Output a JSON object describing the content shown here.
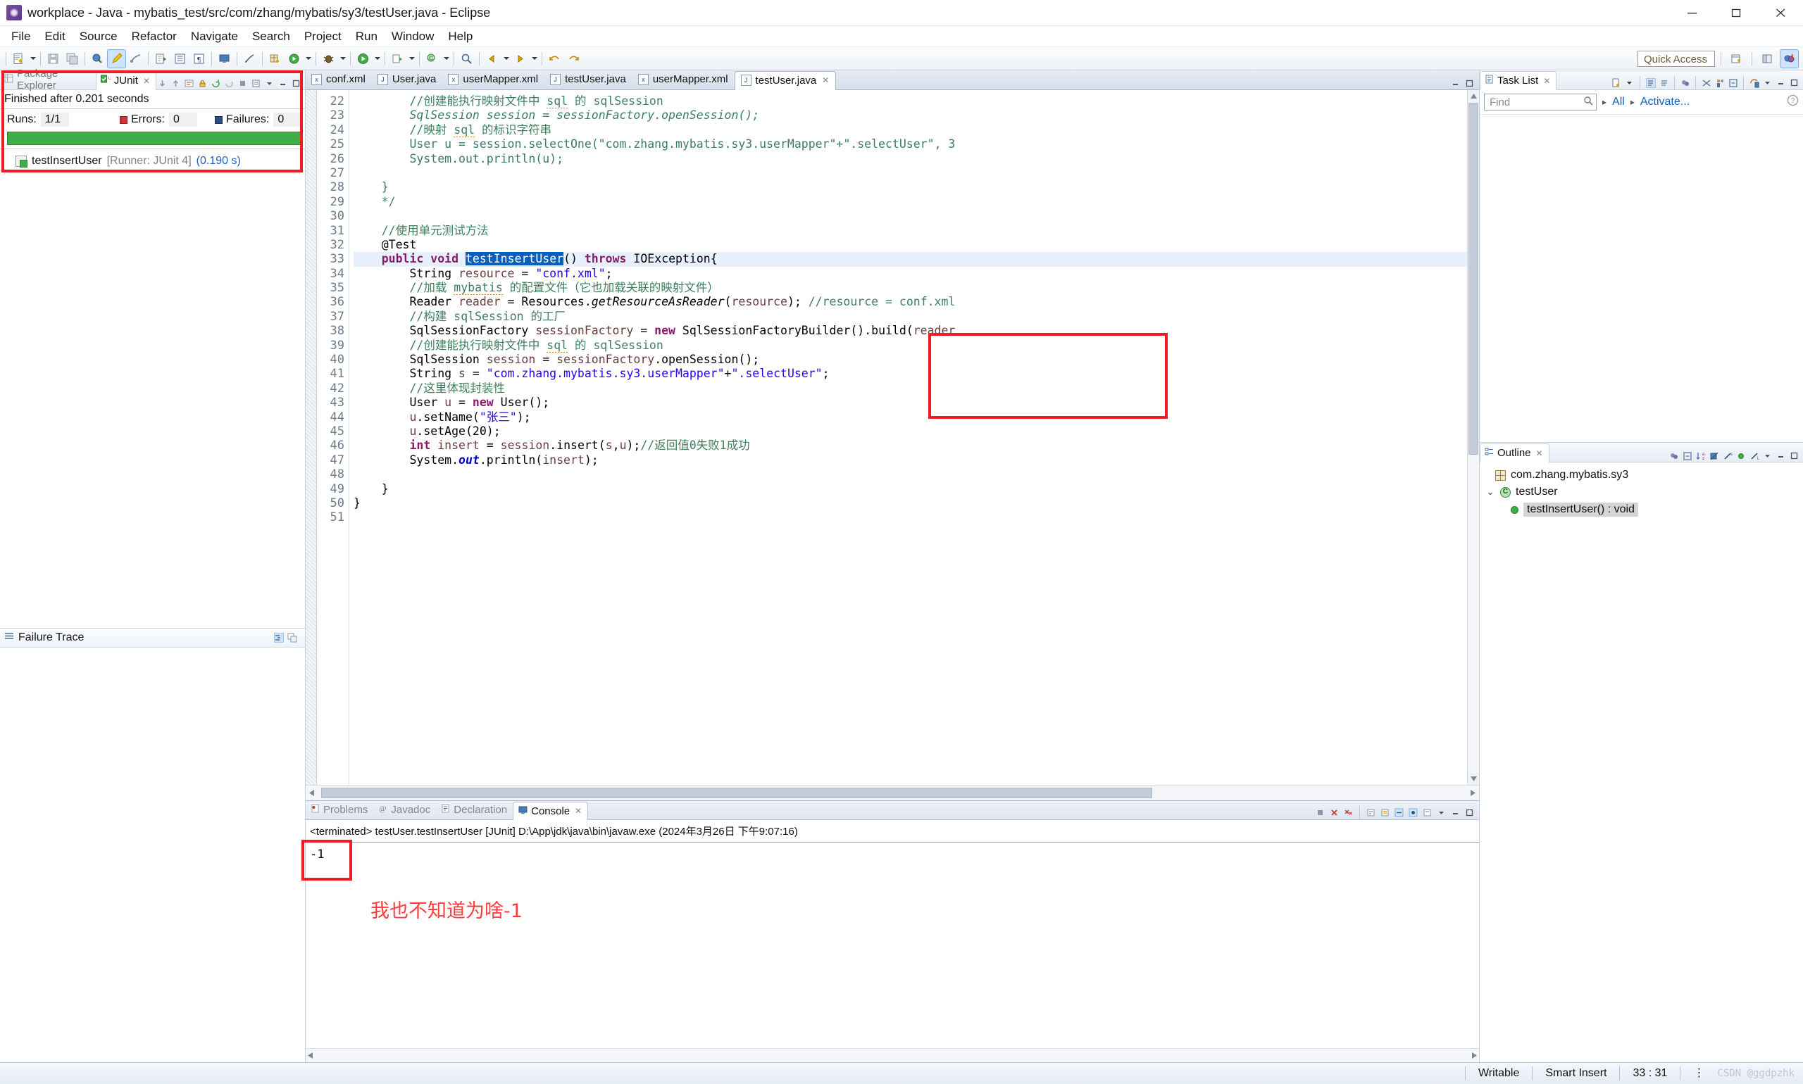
{
  "window": {
    "title": "workplace - Java - mybatis_test/src/com/zhang/mybatis/sy3/testUser.java - Eclipse",
    "app_icon": "eclipse-icon",
    "minimize": "minimize-button",
    "maximize": "maximize-button",
    "close": "close-button"
  },
  "menubar": {
    "items": [
      "File",
      "Edit",
      "Source",
      "Refactor",
      "Navigate",
      "Search",
      "Project",
      "Run",
      "Window",
      "Help"
    ]
  },
  "toolbar": {
    "quick_access_placeholder": "Quick Access",
    "quick_access_value": "",
    "icons": [
      "new-wizard-icon",
      "save-icon",
      "save-all-icon",
      "print-icon",
      "build-icon",
      "pencil-icon",
      "link-icon",
      "export-icon",
      "open-type-icon",
      "format-icon",
      "console-icon",
      "annotation-icon",
      "new-package-icon",
      "run-last-icon",
      "debug-icon",
      "run-icon"
    ]
  },
  "junit_view": {
    "tabs": [
      {
        "label": "Package Explorer",
        "icon": "package-explorer-icon",
        "selected": false
      },
      {
        "label": "JUnit",
        "icon": "junit-icon",
        "selected": true
      }
    ],
    "status": "Finished after 0.201 seconds",
    "counters": [
      {
        "label": "Runs:",
        "value": "1/1",
        "marker": "none"
      },
      {
        "label": "Errors:",
        "value": "0",
        "marker": "error"
      },
      {
        "label": "Failures:",
        "value": "0",
        "marker": "failure"
      }
    ],
    "progress_color": "#3fae46",
    "results": [
      {
        "name": "testInsertUser",
        "runner": "[Runner: JUnit 4]",
        "time": "(0.190 s)"
      }
    ],
    "failure_trace_title": "Failure Trace"
  },
  "editor": {
    "tabs": [
      {
        "label": "conf.xml",
        "icon": "xml-file-icon",
        "glyph": "x",
        "selected": false
      },
      {
        "label": "User.java",
        "icon": "java-file-icon",
        "glyph": "J",
        "selected": false
      },
      {
        "label": "userMapper.xml",
        "icon": "xml-file-icon",
        "glyph": "x",
        "selected": false
      },
      {
        "label": "testUser.java",
        "icon": "java-file-icon",
        "glyph": "J",
        "selected": false
      },
      {
        "label": "userMapper.xml",
        "icon": "xml-file-icon",
        "glyph": "x",
        "selected": false
      },
      {
        "label": "testUser.java",
        "icon": "java-file-icon",
        "glyph": "J",
        "selected": true
      }
    ],
    "first_line_number": 22,
    "line_numbers": [
      22,
      23,
      24,
      25,
      26,
      27,
      28,
      29,
      30,
      31,
      32,
      33,
      34,
      35,
      36,
      37,
      38,
      39,
      40,
      41,
      42,
      43,
      44,
      45,
      46,
      47,
      48,
      49,
      50,
      51
    ],
    "highlighted_line": 33,
    "selected_token": "testInsertUser",
    "lines": [
      "        //创建能执行映射文件中 sql 的 sqlSession",
      "        SqlSession session = sessionFactory.openSession();",
      "        //映射 sql 的标识字符串",
      "        User u = session.selectOne(\"com.zhang.mybatis.sy3.userMapper\"+\".selectUser\", 3",
      "        System.out.println(u);",
      "",
      "    }",
      "    */",
      "",
      "    //使用单元测试方法",
      "    @Test",
      "    public void testInsertUser() throws IOException{",
      "        String resource = \"conf.xml\";",
      "        //加载 mybatis 的配置文件（它也加载关联的映射文件）",
      "        Reader reader = Resources.getResourceAsReader(resource); //resource = conf.xml",
      "        //构建 sqlSession 的工厂",
      "        SqlSessionFactory sessionFactory = new SqlSessionFactoryBuilder().build(reader",
      "        //创建能执行映射文件中 sql 的 sqlSession",
      "        SqlSession session = sessionFactory.openSession();",
      "        String s = \"com.zhang.mybatis.sy3.userMapper\"+\".selectUser\";",
      "        //这里体现封装性",
      "        User u = new User();",
      "        u.setName(\"张三\");",
      "        u.setAge(20);",
      "        int insert = session.insert(s,u);//返回值0失败1成功",
      "        System.out.println(insert);",
      "",
      "    }",
      "}",
      ""
    ],
    "annotation_box_text": "//返回值0失败1成功"
  },
  "console": {
    "tabs": [
      {
        "label": "Problems",
        "icon": "problems-icon",
        "selected": false
      },
      {
        "label": "Javadoc",
        "icon": "javadoc-icon",
        "selected": false
      },
      {
        "label": "Declaration",
        "icon": "declaration-icon",
        "selected": false
      },
      {
        "label": "Console",
        "icon": "console-icon",
        "selected": true
      }
    ],
    "header": "<terminated> testUser.testInsertUser [JUnit] D:\\App\\jdk\\java\\bin\\javaw.exe (2024年3月26日 下午9:07:16)",
    "output": "-1",
    "red_annotation": "我也不知道为啥-1"
  },
  "task_list": {
    "title": "Task List",
    "icon": "task-list-icon",
    "find_placeholder": "Find",
    "find_value": "",
    "breadcrumb": [
      "All",
      "Activate..."
    ],
    "help_icon": "help-icon"
  },
  "outline": {
    "title": "Outline",
    "icon": "outline-icon",
    "rows": [
      {
        "label": "com.zhang.mybatis.sy3",
        "icon": "package-icon",
        "indent": 1,
        "twisty": "",
        "selected": false
      },
      {
        "label": "testUser",
        "icon": "class-icon",
        "indent": 0,
        "twisty": "v",
        "selected": false
      },
      {
        "label": "testInsertUser() : void",
        "icon": "method-icon",
        "indent": 2,
        "twisty": "",
        "selected": true
      }
    ]
  },
  "statusbar": {
    "writable": "Writable",
    "insert_mode": "Smart Insert",
    "cursor_position": "33 : 31",
    "watermark": "CSDN @ggdpzhk"
  },
  "colors": {
    "annotation_red": "#ee1c25",
    "note_red": "#ff3b3b",
    "progress_green": "#3fae46",
    "selection_blue": "#0b5fba",
    "link_blue": "#1060c0"
  }
}
